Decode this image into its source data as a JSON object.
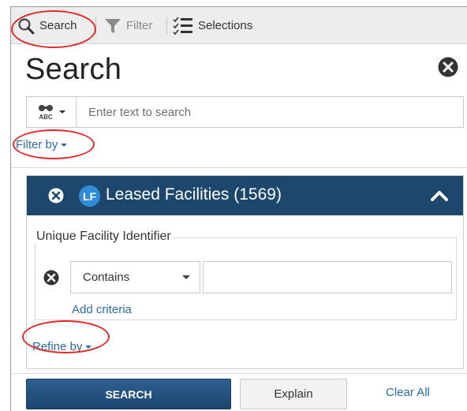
{
  "toolbar": {
    "search_label": "Search",
    "filter_label": "Filter",
    "selections_label": "Selections"
  },
  "panel": {
    "title": "Search"
  },
  "search": {
    "placeholder": "Enter text to search",
    "value": ""
  },
  "filter_by_label": "Filter by",
  "layer": {
    "badge": "LF",
    "title": "Leased Facilities (1569)",
    "header_color": "#1e476e",
    "badge_color": "#2f8bd8",
    "field_label": "Unique Facility Identifier",
    "operator": "Contains",
    "criteria_value": "",
    "add_criteria_label": "Add criteria",
    "refine_by_label": "Refine by"
  },
  "actions": {
    "search_button": "SEARCH",
    "explain_button": "Explain",
    "clear_all": "Clear All"
  },
  "annotation_color": "#e02a2a"
}
